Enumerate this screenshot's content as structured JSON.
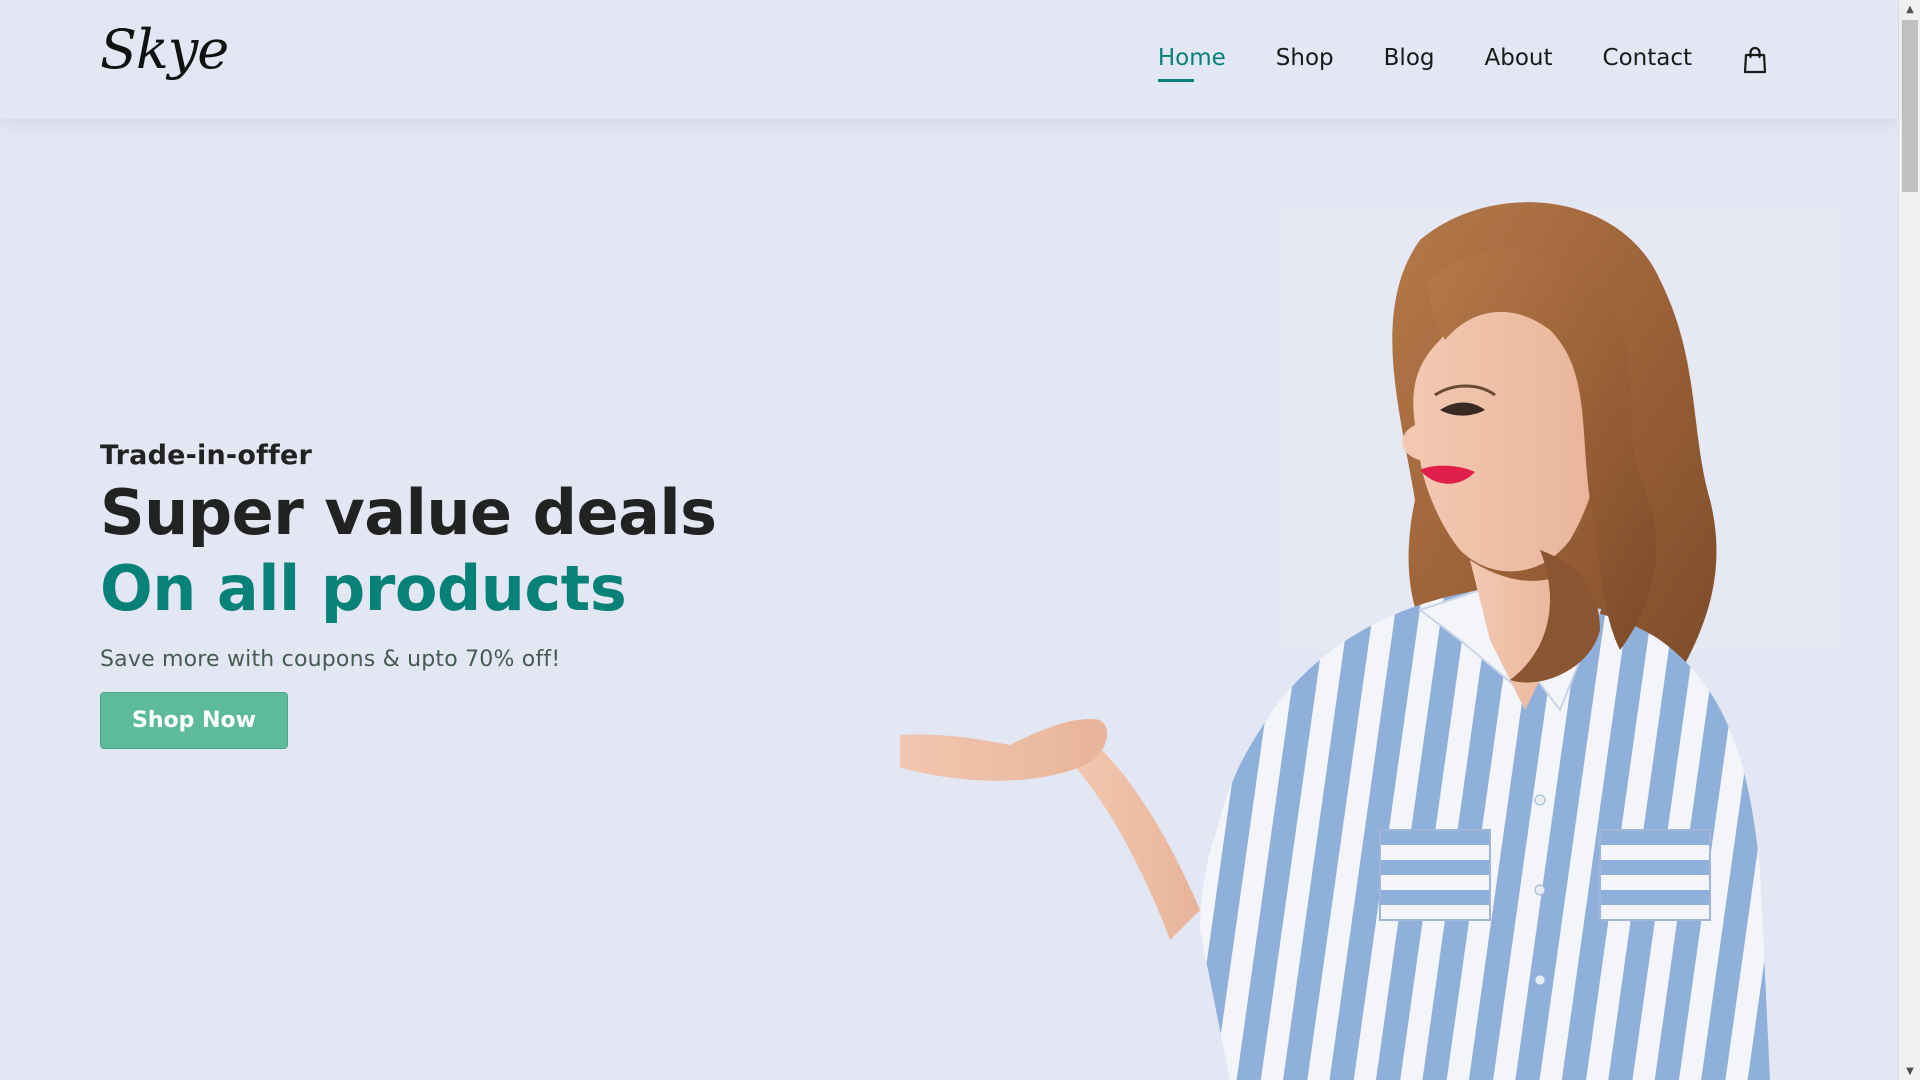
{
  "header": {
    "logo": "Skye",
    "nav": [
      {
        "label": "Home",
        "active": true
      },
      {
        "label": "Shop",
        "active": false
      },
      {
        "label": "Blog",
        "active": false
      },
      {
        "label": "About",
        "active": false
      },
      {
        "label": "Contact",
        "active": false
      }
    ],
    "cart_icon": "shopping-bag-icon"
  },
  "hero": {
    "eyebrow": "Trade-in-offer",
    "headline_line1": "Super value deals",
    "headline_line2": "On all products",
    "subtext": "Save more with coupons & upto 70% off!",
    "cta_label": "Shop Now",
    "image": "woman-striped-shirt-presenting"
  },
  "colors": {
    "background": "#e3e6f3",
    "accent": "#088178",
    "button": "#5dbb9c",
    "text": "#222222"
  }
}
